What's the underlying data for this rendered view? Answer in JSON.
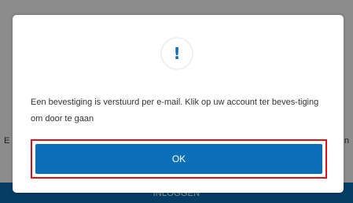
{
  "background": {
    "text_left": "E",
    "text_right": "n",
    "login_label": "INLOGGEN"
  },
  "dialog": {
    "icon": "exclamation-icon",
    "icon_glyph": "!",
    "message": "Een bevestiging is verstuurd per e-mail. Klik op uw account ter beves-tiging om door te gaan",
    "ok_label": "OK"
  },
  "colors": {
    "accent": "#0b6fb8",
    "highlight_border": "#e0101a"
  }
}
